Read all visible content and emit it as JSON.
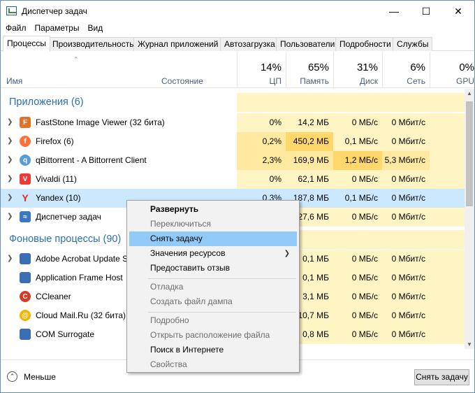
{
  "window": {
    "title": "Диспетчер задач"
  },
  "menu": [
    "Файл",
    "Параметры",
    "Вид"
  ],
  "tabs": [
    "Процессы",
    "Производительность",
    "Журнал приложений",
    "Автозагрузка",
    "Пользователи",
    "Подробности",
    "Службы"
  ],
  "header": {
    "name": "Имя",
    "state": "Состояние",
    "columns": [
      {
        "pct": "14%",
        "label": "ЦП"
      },
      {
        "pct": "65%",
        "label": "Память"
      },
      {
        "pct": "31%",
        "label": "Диск"
      },
      {
        "pct": "6%",
        "label": "Сеть"
      },
      {
        "pct": "0%",
        "label": "GPU"
      }
    ]
  },
  "groups": {
    "apps": "Приложения (6)",
    "background": "Фоновые процессы (90)"
  },
  "apps": [
    {
      "name": "FastStone Image Viewer (32 бита)",
      "icon": "faststone-icon",
      "color": "#e0722a",
      "cpu": "0%",
      "mem": "14,2 МБ",
      "disk": "0 МБ/с",
      "net": "0 Мбит/с"
    },
    {
      "name": "Firefox (6)",
      "icon": "firefox-icon",
      "color": "#ff7139",
      "cpu": "0,2%",
      "mem": "450,2 МБ",
      "disk": "0,1 МБ/с",
      "net": "0 Мбит/с"
    },
    {
      "name": "qBittorrent - A Bittorrent Client",
      "icon": "qbittorrent-icon",
      "color": "#5b9bd5",
      "cpu": "2,3%",
      "mem": "169,9 МБ",
      "disk": "1,2 МБ/с",
      "net": "5,3 Мбит/с"
    },
    {
      "name": "Vivaldi (11)",
      "icon": "vivaldi-icon",
      "color": "#ef3939",
      "cpu": "0%",
      "mem": "62,1 МБ",
      "disk": "0 МБ/с",
      "net": "0 Мбит/с"
    },
    {
      "name": "Yandex (10)",
      "icon": "yandex-icon",
      "color": "#ffffff",
      "cpu": "0,3%",
      "mem": "187,8 МБ",
      "disk": "0,1 МБ/с",
      "net": "0 Мбит/с"
    },
    {
      "name": "Диспетчер задач",
      "icon": "task-manager-icon",
      "color": "#3a78c3",
      "cpu": "",
      "mem": "27,6 МБ",
      "disk": "0 МБ/с",
      "net": "0 Мбит/с"
    }
  ],
  "background": [
    {
      "name": "Adobe Acrobat Update Ser",
      "icon": "acrobat-update-icon",
      "color": "#3a6fb5",
      "mem": "0,1 МБ",
      "disk": "0 МБ/с",
      "net": "0 Мбит/с"
    },
    {
      "name": "Application Frame Host",
      "icon": "app-frame-host-icon",
      "color": "#3a6fb5",
      "mem": "0,1 МБ",
      "disk": "0 МБ/с",
      "net": "0 Мбит/с"
    },
    {
      "name": "CCleaner",
      "icon": "ccleaner-icon",
      "color": "#d23b2a",
      "mem": "3,1 МБ",
      "disk": "0 МБ/с",
      "net": "0 Мбит/с"
    },
    {
      "name": "Cloud Mail.Ru (32 бита)",
      "icon": "cloud-mail-icon",
      "color": "#2f7fd8",
      "mem": "10,7 МБ",
      "disk": "0 МБ/с",
      "net": "0 Мбит/с"
    },
    {
      "name": "COM Surrogate",
      "icon": "com-surrogate-icon",
      "color": "#3a6fb5",
      "mem": "0,8 МБ",
      "disk": "0 МБ/с",
      "net": "0 Мбит/с"
    }
  ],
  "context_menu": {
    "items": [
      {
        "label": "Развернуть",
        "style": "bold"
      },
      {
        "label": "Переключиться",
        "style": "disabled"
      },
      {
        "label": "Снять задачу",
        "style": "hl"
      },
      {
        "label": "Значения ресурсов",
        "style": "submenu"
      },
      {
        "label": "Предоставить отзыв",
        "style": ""
      },
      {
        "label": "Отладка",
        "style": "disabled"
      },
      {
        "label": "Создать файл дампа",
        "style": "disabled"
      },
      {
        "label": "Подробно",
        "style": "disabled"
      },
      {
        "label": "Открыть расположение файла",
        "style": "disabled"
      },
      {
        "label": "Поиск в Интернете",
        "style": ""
      },
      {
        "label": "Свойства",
        "style": "disabled"
      }
    ]
  },
  "footer": {
    "less": "Меньше",
    "end_task": "Снять задачу"
  },
  "colors": {
    "heat_light": "#fff4c4",
    "heat_mid": "#ffe9a0",
    "heat_strong": "#ffd76a",
    "selection": "#cce8ff",
    "menu_highlight": "#91c9f7",
    "group_text": "#2a6fb7"
  }
}
